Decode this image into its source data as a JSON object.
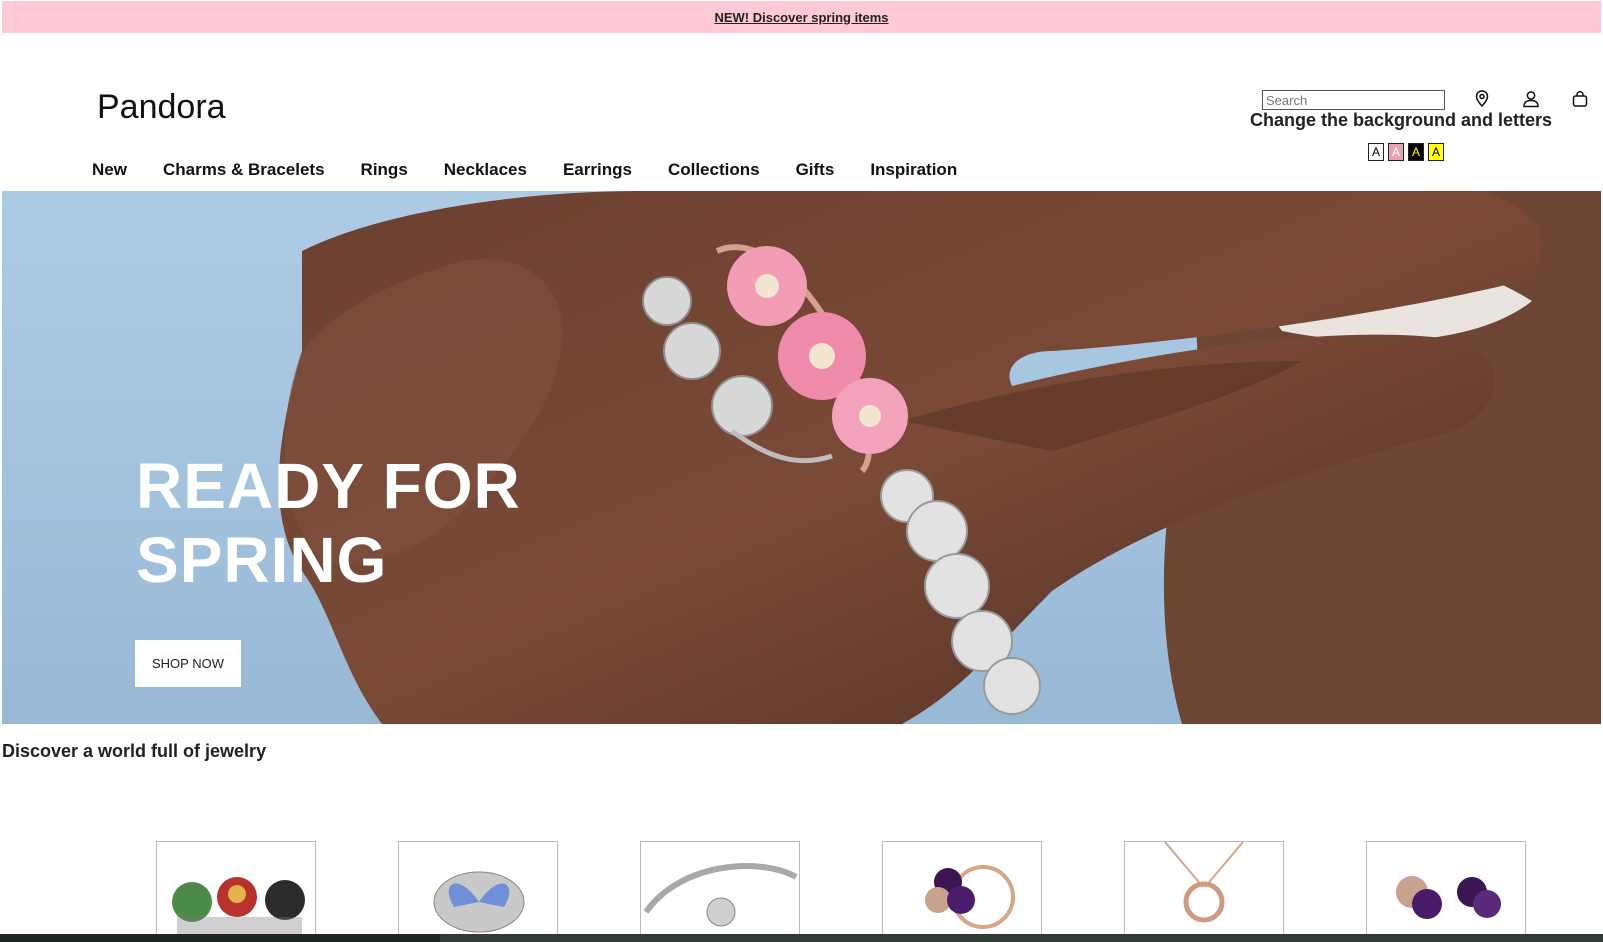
{
  "promo": {
    "text": "NEW! Discover spring items"
  },
  "header": {
    "logo": "Pandora",
    "search_placeholder": "Search",
    "icons": [
      "location-pin-icon",
      "user-icon",
      "shopping-bag-icon"
    ]
  },
  "accessibility": {
    "title": "Change the background and letters",
    "swatches": [
      {
        "label": "A",
        "bg": "#ffffff",
        "fg": "#000000"
      },
      {
        "label": "A",
        "bg": "#e7a3b5",
        "fg": "#ffffff"
      },
      {
        "label": "A",
        "bg": "#000000",
        "fg": "#ffff00"
      },
      {
        "label": "A",
        "bg": "#ffff00",
        "fg": "#000000"
      }
    ]
  },
  "nav": {
    "items": [
      "New",
      "Charms & Bracelets",
      "Rings",
      "Necklaces",
      "Earrings",
      "Collections",
      "Gifts",
      "Inspiration"
    ]
  },
  "hero": {
    "title_line1": "READY FOR",
    "title_line2": "SPRING",
    "cta": "SHOP NOW"
  },
  "section": {
    "title": "Discover a world full of jewelry"
  },
  "products": [
    {
      "icon": "superhero-charms-icon"
    },
    {
      "icon": "butterfly-charm-icon"
    },
    {
      "icon": "bracelet-icon"
    },
    {
      "icon": "pansy-ring-icon"
    },
    {
      "icon": "o-pendant-necklace-icon"
    },
    {
      "icon": "pansy-earrings-icon"
    }
  ],
  "colors": {
    "promo_bg": "#ffc9d6",
    "accent_pink": "#e7a3b5"
  }
}
